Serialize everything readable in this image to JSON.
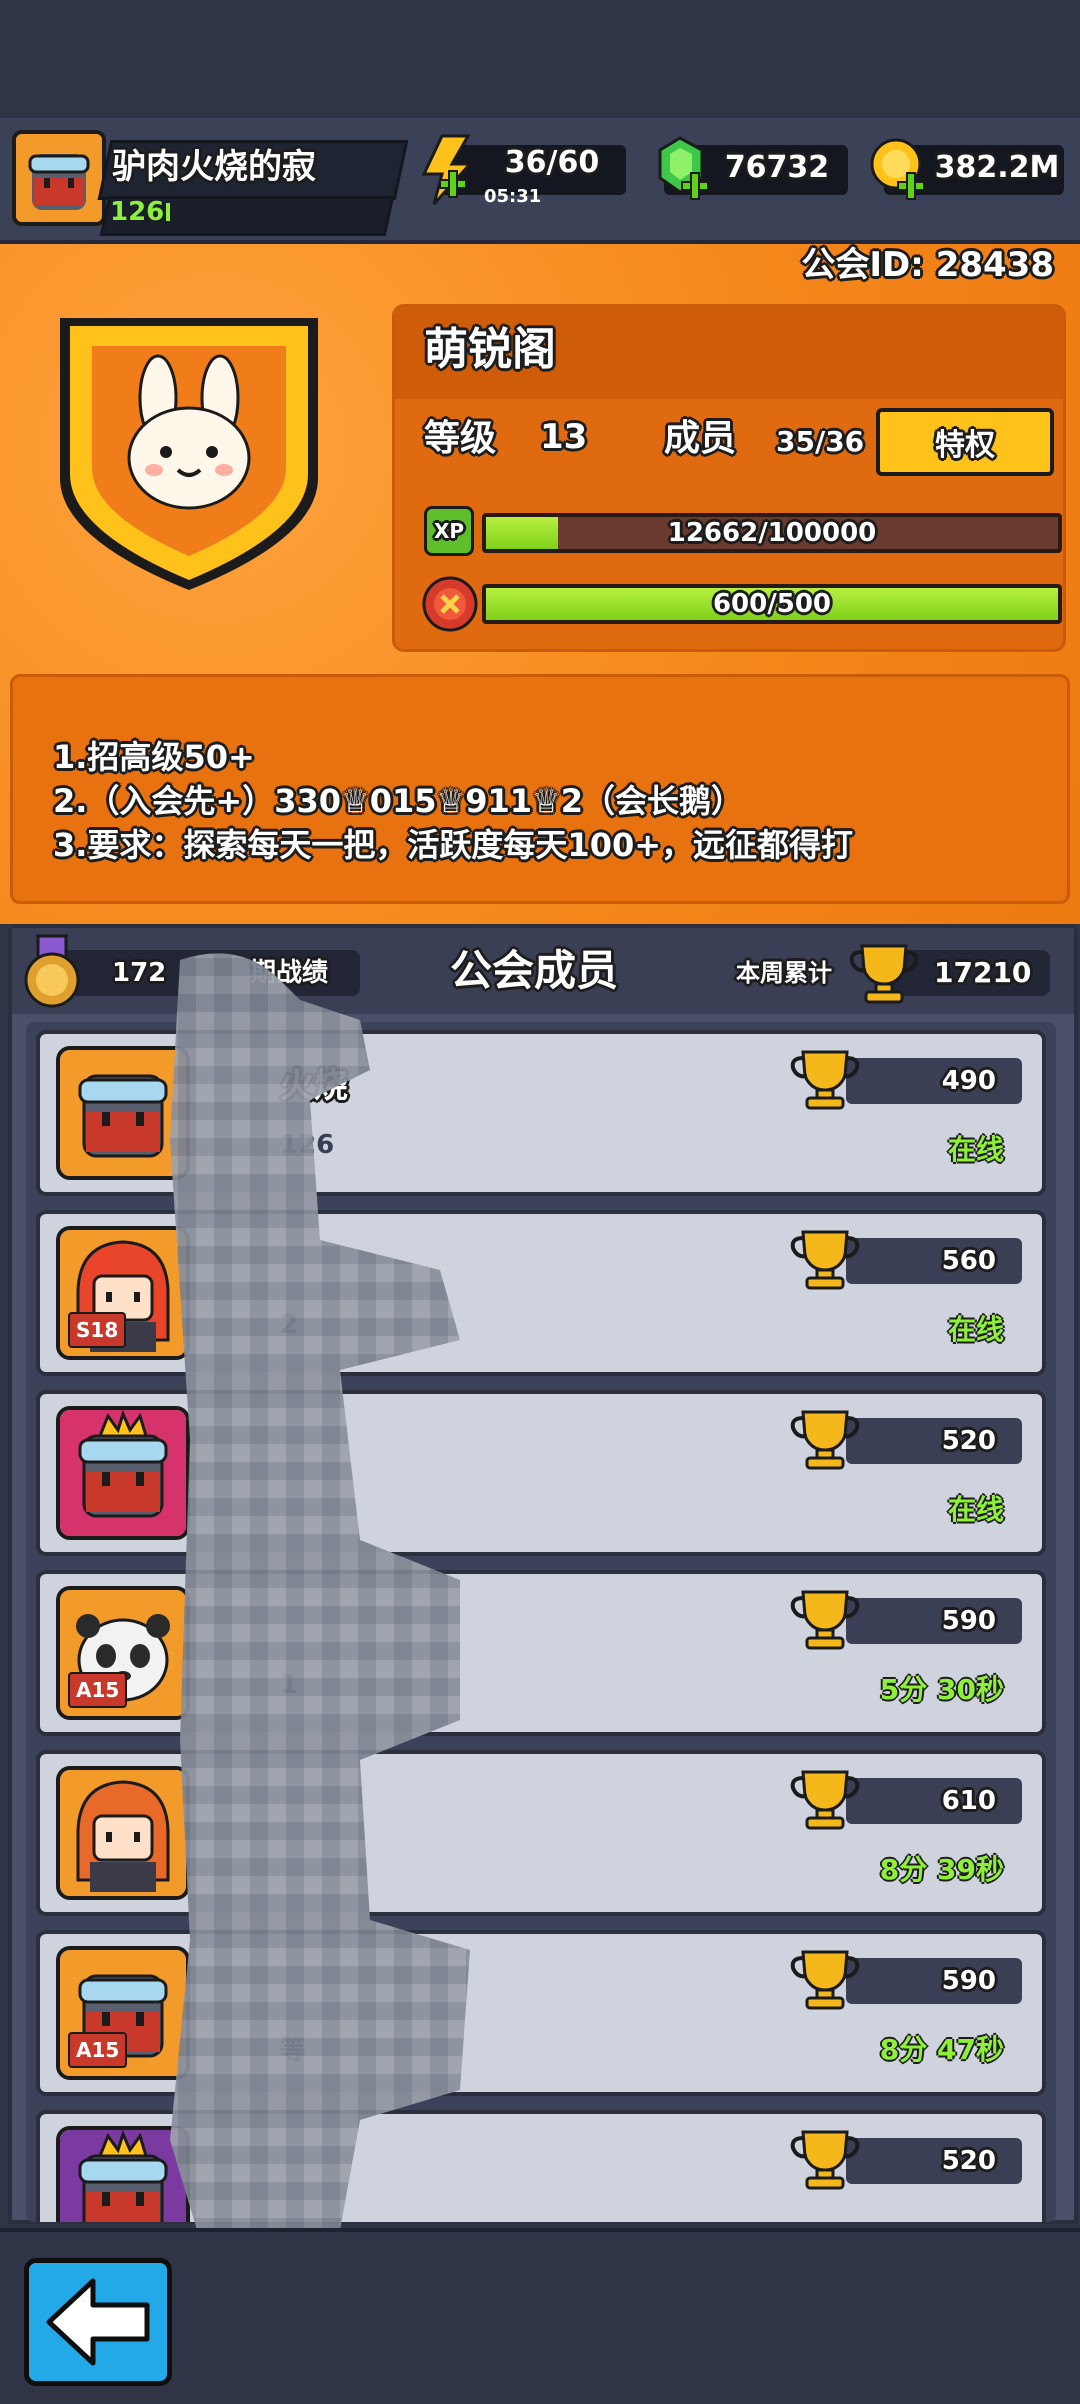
{
  "player": {
    "name": "驴肉火烧的寂",
    "level": "126"
  },
  "resources": {
    "energy": "36/60",
    "energy_timer": "05:31",
    "gems": "76732",
    "gold": "382.2M"
  },
  "guild": {
    "id_label": "公会ID: 28438",
    "name": "萌锐阁",
    "level_label": "等级",
    "level": "13",
    "members_label": "成员",
    "members_count": "35/36",
    "privilege_button": "特权",
    "xp_icon": "XP",
    "xp_text": "12662/100000",
    "xp_fraction": 0.12662,
    "activity_text": "600/500",
    "activity_fraction": 1.0
  },
  "notice": [
    "1.招高级50+",
    "2.（入会先+）330♕015♕911♕2（会长鹅）",
    "3.要求：探索每天一把，活跃度每天100+，远征都得打"
  ],
  "members_panel": {
    "left_value": "172",
    "left_label": "期战绩",
    "title": "公会成员",
    "weekly_label": "本周累计",
    "weekly_total": "17210"
  },
  "members": [
    {
      "trophies": "490",
      "status": "在线",
      "badge": "",
      "name_fragment": "火烧",
      "level_fragment": "126",
      "avatar": "goggles-ninja",
      "frame": "orange"
    },
    {
      "trophies": "560",
      "status": "在线",
      "badge": "S18",
      "name_fragment": "",
      "level_fragment": "2",
      "avatar": "red-hair",
      "frame": "orange"
    },
    {
      "trophies": "520",
      "status": "在线",
      "badge": "",
      "name_fragment": "",
      "level_fragment": "",
      "avatar": "crowned-ninja",
      "frame": "pink"
    },
    {
      "trophies": "590",
      "status": "5分 30秒",
      "badge": "A15",
      "name_fragment": "",
      "level_fragment": "1",
      "avatar": "panda",
      "frame": "orange"
    },
    {
      "trophies": "610",
      "status": "8分 39秒",
      "badge": "",
      "name_fragment": "",
      "level_fragment": "",
      "avatar": "ginger-hair",
      "frame": "orange"
    },
    {
      "trophies": "590",
      "status": "8分 47秒",
      "badge": "A15",
      "name_fragment": "",
      "level_fragment": "等",
      "avatar": "goggles-ninja",
      "frame": "orange"
    },
    {
      "trophies": "520",
      "status": "",
      "badge": "",
      "name_fragment": "",
      "level_fragment": "",
      "avatar": "crowned-ninja",
      "frame": "purple"
    }
  ],
  "colors": {
    "orange": "#f4861a",
    "panel": "#4a5068",
    "online": "#8ff03a",
    "xp_fill": "#7fd11a",
    "button_yellow": "#ffc21a",
    "back_button": "#23a8e8"
  }
}
